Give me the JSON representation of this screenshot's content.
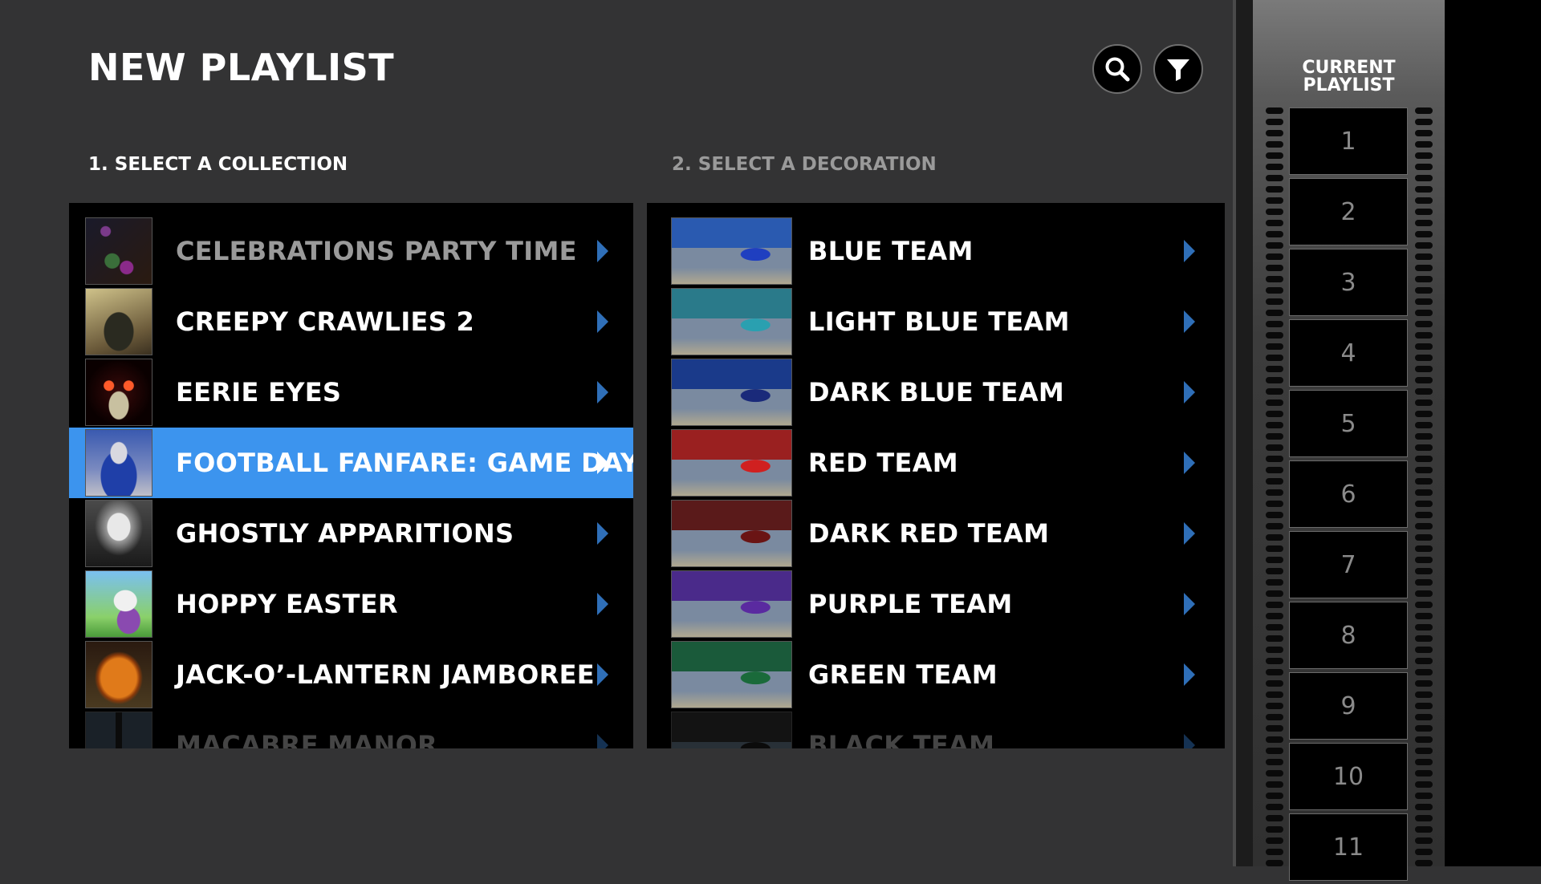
{
  "header": {
    "title": "NEW PLAYLIST",
    "search_icon": "search-icon",
    "filter_icon": "filter-icon"
  },
  "collections": {
    "heading": "1. SELECT A COLLECTION",
    "items": [
      {
        "label": "CELEBRATIONS PARTY TIME"
      },
      {
        "label": "CREEPY CRAWLIES 2"
      },
      {
        "label": "EERIE EYES"
      },
      {
        "label": "FOOTBALL FANFARE: GAME DAY!"
      },
      {
        "label": "GHOSTLY APPARITIONS"
      },
      {
        "label": "HOPPY EASTER"
      },
      {
        "label": "JACK-O’-LANTERN JAMBOREE"
      },
      {
        "label": "MACABRE MANOR"
      }
    ],
    "selected_index": 3
  },
  "decorations": {
    "heading": "2. SELECT A DECORATION",
    "items": [
      {
        "label": "BLUE TEAM"
      },
      {
        "label": "LIGHT BLUE TEAM"
      },
      {
        "label": "DARK BLUE TEAM"
      },
      {
        "label": "RED TEAM"
      },
      {
        "label": "DARK RED TEAM"
      },
      {
        "label": "PURPLE TEAM"
      },
      {
        "label": "GREEN TEAM"
      },
      {
        "label": "BLACK TEAM"
      }
    ]
  },
  "playlist": {
    "heading_line1": "CURRENT",
    "heading_line2": "PLAYLIST",
    "slots": [
      "1",
      "2",
      "3",
      "4",
      "5",
      "6",
      "7",
      "8",
      "9",
      "10",
      "11"
    ]
  },
  "colors": {
    "background": "#333334",
    "panel": "#000000",
    "selected": "#3c94ee",
    "chevron": "#2f6fb8",
    "muted_text": "#9a9a9a"
  }
}
